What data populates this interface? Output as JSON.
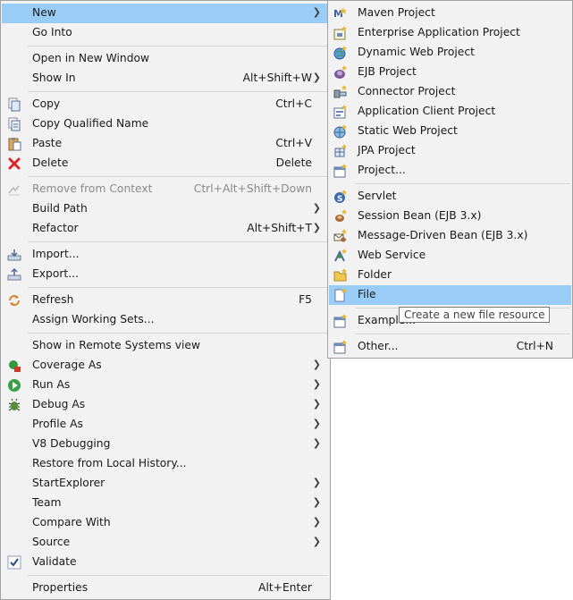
{
  "main_menu": {
    "items": [
      {
        "label": "New",
        "accel": "",
        "arrow": true,
        "icon": "",
        "highlighted": true
      },
      {
        "label": "Go Into",
        "accel": "",
        "arrow": false,
        "icon": ""
      },
      {
        "label": "Open in New Window",
        "accel": "",
        "arrow": false,
        "icon": ""
      },
      {
        "label": "Show In",
        "accel": "Alt+Shift+W",
        "arrow": true,
        "icon": ""
      },
      {
        "label": "Copy",
        "accel": "Ctrl+C",
        "arrow": false,
        "icon": "copy-icon"
      },
      {
        "label": "Copy Qualified Name",
        "accel": "",
        "arrow": false,
        "icon": "copy-qualified-icon"
      },
      {
        "label": "Paste",
        "accel": "Ctrl+V",
        "arrow": false,
        "icon": "paste-icon"
      },
      {
        "label": "Delete",
        "accel": "Delete",
        "arrow": false,
        "icon": "delete-icon"
      },
      {
        "label": "Remove from Context",
        "accel": "Ctrl+Alt+Shift+Down",
        "arrow": false,
        "icon": "remove-context-icon",
        "disabled": true
      },
      {
        "label": "Build Path",
        "accel": "",
        "arrow": true,
        "icon": ""
      },
      {
        "label": "Refactor",
        "accel": "Alt+Shift+T",
        "arrow": true,
        "icon": ""
      },
      {
        "label": "Import...",
        "accel": "",
        "arrow": false,
        "icon": "import-icon"
      },
      {
        "label": "Export...",
        "accel": "",
        "arrow": false,
        "icon": "export-icon"
      },
      {
        "label": "Refresh",
        "accel": "F5",
        "arrow": false,
        "icon": "refresh-icon"
      },
      {
        "label": "Assign Working Sets...",
        "accel": "",
        "arrow": false,
        "icon": ""
      },
      {
        "label": "Show in Remote Systems view",
        "accel": "",
        "arrow": false,
        "icon": ""
      },
      {
        "label": "Coverage As",
        "accel": "",
        "arrow": true,
        "icon": "coverage-icon"
      },
      {
        "label": "Run As",
        "accel": "",
        "arrow": true,
        "icon": "run-icon"
      },
      {
        "label": "Debug As",
        "accel": "",
        "arrow": true,
        "icon": "debug-icon"
      },
      {
        "label": "Profile As",
        "accel": "",
        "arrow": true,
        "icon": ""
      },
      {
        "label": "V8 Debugging",
        "accel": "",
        "arrow": true,
        "icon": ""
      },
      {
        "label": "Restore from Local History...",
        "accel": "",
        "arrow": false,
        "icon": ""
      },
      {
        "label": "StartExplorer",
        "accel": "",
        "arrow": true,
        "icon": ""
      },
      {
        "label": "Team",
        "accel": "",
        "arrow": true,
        "icon": ""
      },
      {
        "label": "Compare With",
        "accel": "",
        "arrow": true,
        "icon": ""
      },
      {
        "label": "Source",
        "accel": "",
        "arrow": true,
        "icon": ""
      },
      {
        "label": "Validate",
        "accel": "",
        "arrow": false,
        "icon": "checkmark-icon"
      },
      {
        "label": "Properties",
        "accel": "Alt+Enter",
        "arrow": false,
        "icon": ""
      }
    ]
  },
  "submenu": {
    "items": [
      {
        "label": "Maven Project",
        "accel": "",
        "icon": "maven-project-icon"
      },
      {
        "label": "Enterprise Application Project",
        "accel": "",
        "icon": "enterprise-app-project-icon"
      },
      {
        "label": "Dynamic Web Project",
        "accel": "",
        "icon": "dynamic-web-project-icon"
      },
      {
        "label": "EJB Project",
        "accel": "",
        "icon": "ejb-project-icon"
      },
      {
        "label": "Connector Project",
        "accel": "",
        "icon": "connector-project-icon"
      },
      {
        "label": "Application Client Project",
        "accel": "",
        "icon": "app-client-project-icon"
      },
      {
        "label": "Static Web Project",
        "accel": "",
        "icon": "static-web-project-icon"
      },
      {
        "label": "JPA Project",
        "accel": "",
        "icon": "jpa-project-icon"
      },
      {
        "label": "Project...",
        "accel": "",
        "icon": "project-icon"
      },
      {
        "label": "Servlet",
        "accel": "",
        "icon": "servlet-icon"
      },
      {
        "label": "Session Bean (EJB 3.x)",
        "accel": "",
        "icon": "session-bean-icon"
      },
      {
        "label": "Message-Driven Bean (EJB 3.x)",
        "accel": "",
        "icon": "message-driven-bean-icon"
      },
      {
        "label": "Web Service",
        "accel": "",
        "icon": "web-service-icon"
      },
      {
        "label": "Folder",
        "accel": "",
        "icon": "folder-icon"
      },
      {
        "label": "File",
        "accel": "",
        "icon": "file-icon",
        "highlighted": true
      },
      {
        "label": "Example...",
        "accel": "",
        "icon": "example-icon"
      },
      {
        "label": "Other...",
        "accel": "Ctrl+N",
        "icon": "other-wizard-icon"
      }
    ]
  },
  "tooltip": {
    "text": "Create a new file resource"
  },
  "colors": {
    "highlight": "#99ccf7",
    "menu_bg": "#f2f2f2",
    "border": "#a0a0a0",
    "disabled_text": "#8a8a8a"
  }
}
